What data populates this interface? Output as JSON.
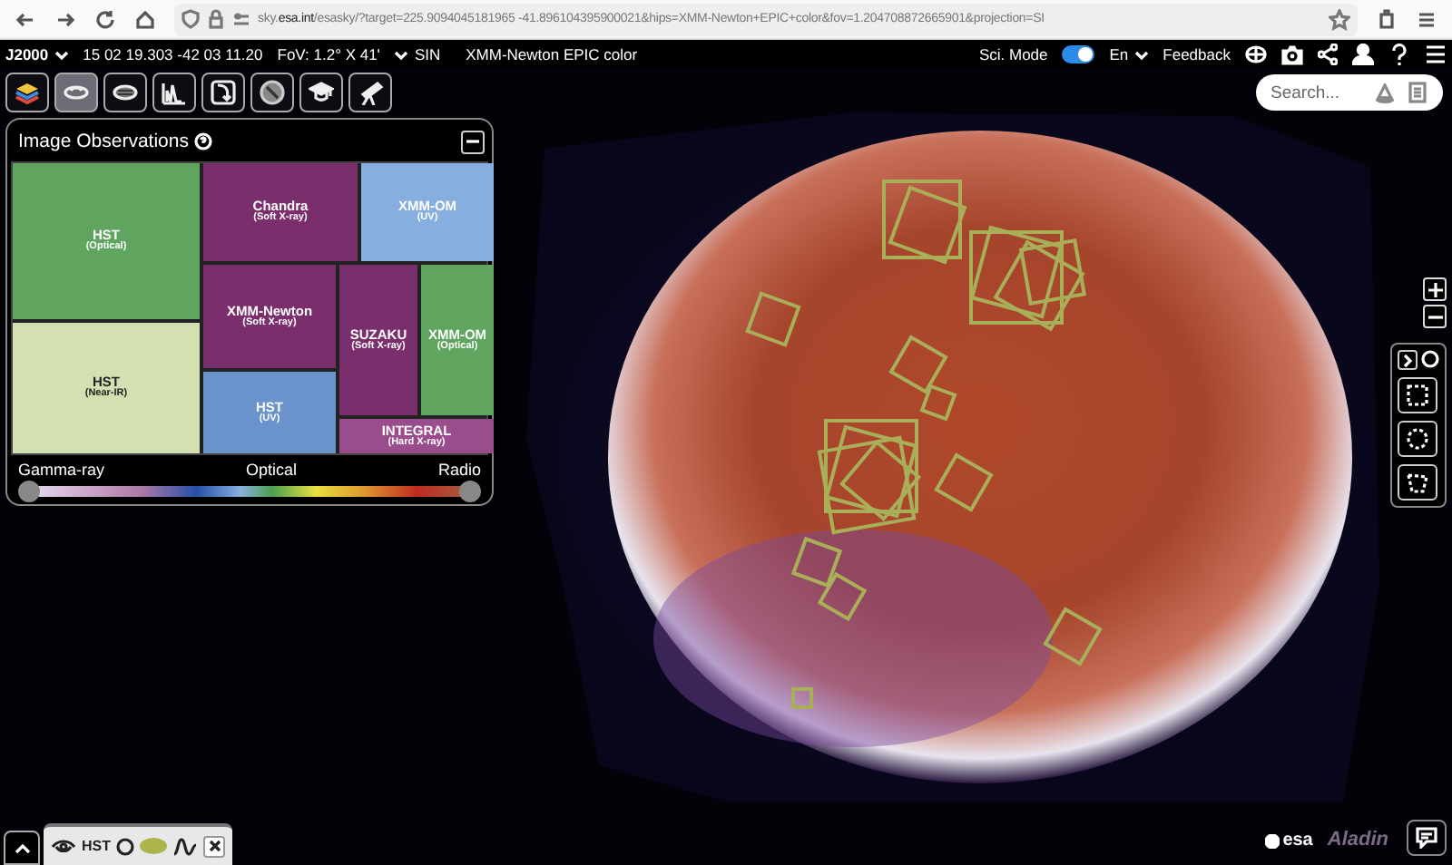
{
  "browser": {
    "url": "sky.**esa.int**/esasky/?target=225.9094045181965 -41.896104395900021&hips=XMM-Newton+EPIC+color&fov=1.204708872665901&projection=SI"
  },
  "topbar": {
    "frame": "J2000",
    "coordinates": "15 02 19.303 -42 03 11.20",
    "fov": "FoV: 1.2° X 41'",
    "projection": "SIN",
    "survey": "XMM-Newton EPIC color",
    "sci_mode": {
      "label": "Sci. Mode",
      "on": true
    },
    "language": "En",
    "feedback": "Feedback"
  },
  "toolbar": [
    {
      "kind": "layers",
      "selected": false
    },
    {
      "kind": "galaxy",
      "selected": true
    },
    {
      "kind": "catalog",
      "selected": false
    },
    {
      "kind": "spectra",
      "selected": false
    },
    {
      "kind": "timeseries",
      "selected": false
    },
    {
      "kind": "planning",
      "selected": false
    },
    {
      "kind": "education",
      "selected": false
    },
    {
      "kind": "telescope",
      "selected": false
    }
  ],
  "search": {
    "placeholder": "Search..."
  },
  "observations_panel": {
    "title": "Image Observations",
    "tiles": [
      {
        "name": "HST",
        "band": "(Optical)",
        "color": "#5fa55f"
      },
      {
        "name": "HST",
        "band": "(Near-IR)",
        "color": "#d3e1b2"
      },
      {
        "name": "Chandra",
        "band": "(Soft X-ray)",
        "color": "#7a2f6c"
      },
      {
        "name": "XMM-OM",
        "band": "(UV)",
        "color": "#86afdf"
      },
      {
        "name": "XMM-Newton",
        "band": "(Soft X-ray)",
        "color": "#7a2f6c"
      },
      {
        "name": "HST",
        "band": "(UV)",
        "color": "#6a93cb"
      },
      {
        "name": "SUZAKU",
        "band": "(Soft X-ray)",
        "color": "#7a2f6c"
      },
      {
        "name": "XMM-OM",
        "band": "(Optical)",
        "color": "#5fa55f"
      },
      {
        "name": "INTEGRAL",
        "band": "(Hard X-ray)",
        "color": "#9a4d8c"
      }
    ],
    "wavelength": {
      "labels": [
        "Gamma-ray",
        "Optical",
        "Radio"
      ],
      "thumbs": [
        {
          "level": 0
        },
        {
          "level": 1
        }
      ]
    }
  },
  "bottom_tab": {
    "label": "HST",
    "color": "#acb44c"
  },
  "logos": {
    "esa": "esa",
    "aladin": "Aladin"
  }
}
